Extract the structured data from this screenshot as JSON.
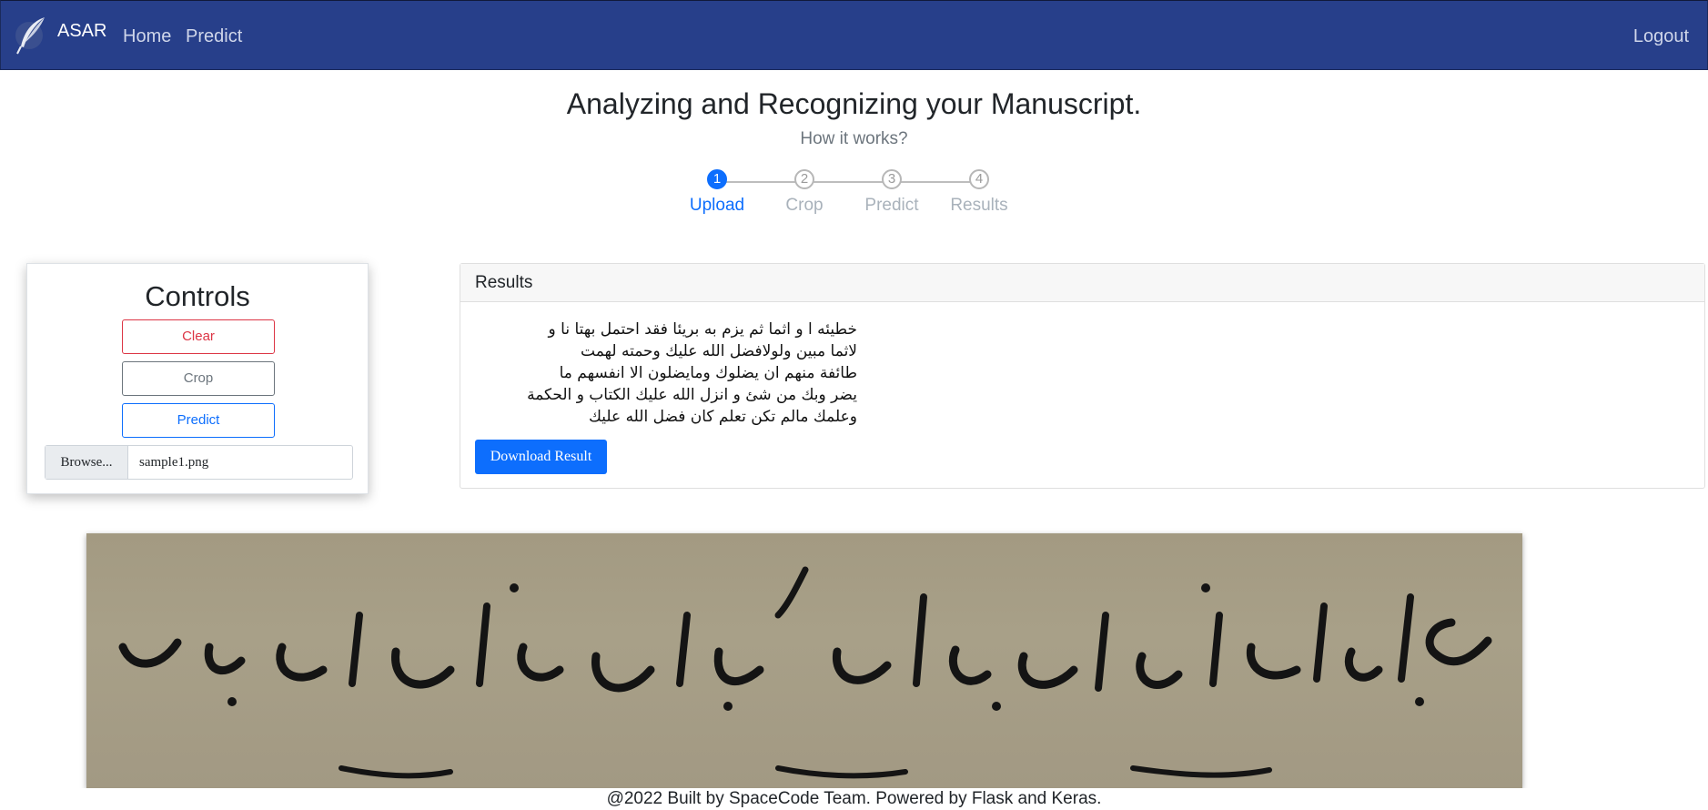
{
  "navbar": {
    "brand": "ASAR",
    "logo_icon": "feather-quill-icon",
    "links": {
      "home": "Home",
      "predict": "Predict"
    },
    "logout": "Logout",
    "background_color": "#273f8a"
  },
  "header": {
    "title": "Analyzing and Recognizing your Manuscript.",
    "subtitle": "How it works?"
  },
  "stepper": {
    "active_step": 1,
    "steps": [
      {
        "number": "1",
        "label": "Upload"
      },
      {
        "number": "2",
        "label": "Crop"
      },
      {
        "number": "3",
        "label": "Predict"
      },
      {
        "number": "4",
        "label": "Results"
      }
    ]
  },
  "controls": {
    "title": "Controls",
    "clear": "Clear",
    "crop": "Crop",
    "predict": "Predict",
    "browse": "Browse...",
    "file_name": "sample1.png"
  },
  "results": {
    "header": "Results",
    "lines": [
      "خطيئه ا و اثما ثم يزم به بريئا فقد احتمل بهتا نا و",
      "لاثما مبين ولولافضل الله عليك وحمته لهمت",
      "طائفة منهم ان يضلوك ومايضلون الا انفسهم ما",
      "يضر وبك من شئ و انزل الله عليك الكتاب و الحكمة",
      "وعلمك مالم تكن تعلم كان فضل الله عليك"
    ],
    "download": "Download Result"
  },
  "footer": "@2022 Built by SpaceCode Team. Powered by Flask and Keras.",
  "colors": {
    "primary": "#0d6efd",
    "danger": "#dc3545",
    "secondary": "#6c757d"
  }
}
